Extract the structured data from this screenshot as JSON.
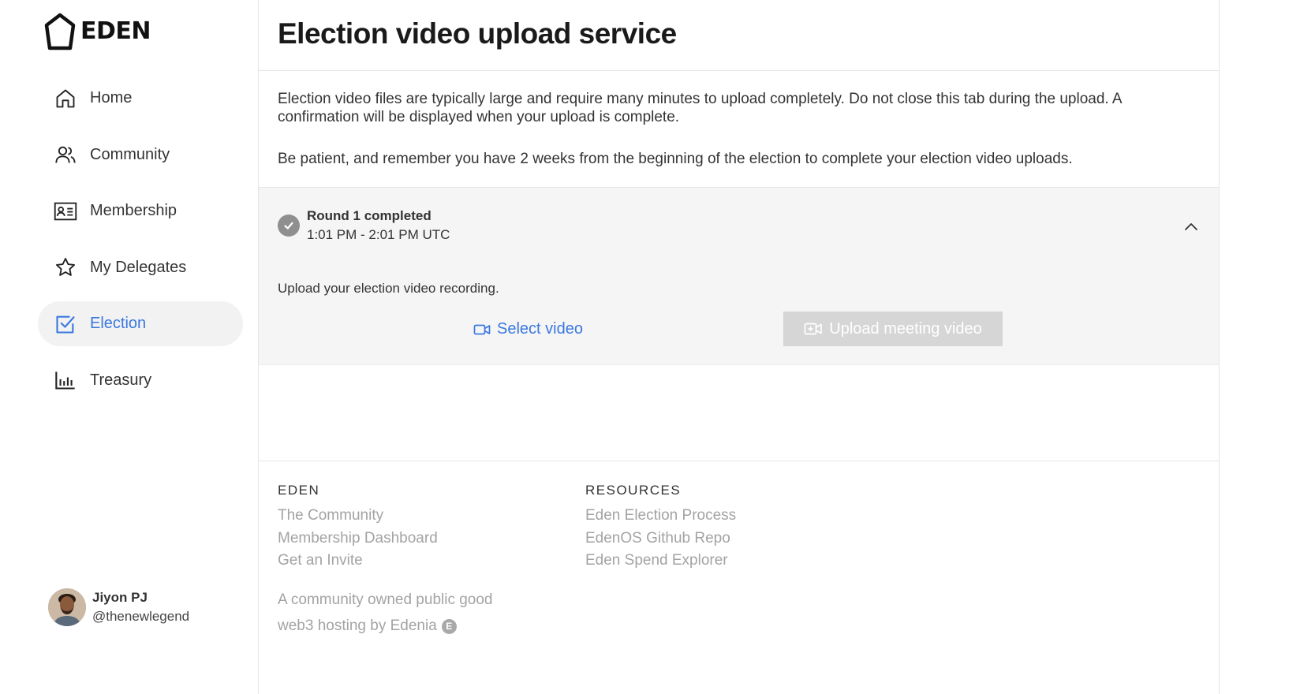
{
  "brand": {
    "logo_text": "EDEN",
    "logo_icon": "pentagon-logo-icon"
  },
  "sidebar": {
    "items": [
      {
        "label": "Home",
        "icon": "home-icon",
        "active": false
      },
      {
        "label": "Community",
        "icon": "users-icon",
        "active": false
      },
      {
        "label": "Membership",
        "icon": "id-card-icon",
        "active": false
      },
      {
        "label": "My Delegates",
        "icon": "star-icon",
        "active": false
      },
      {
        "label": "Election",
        "icon": "checkbox-icon",
        "active": true
      },
      {
        "label": "Treasury",
        "icon": "bar-chart-icon",
        "active": false
      }
    ],
    "user": {
      "name": "Jiyon PJ",
      "handle": "@thenewlegend"
    }
  },
  "main": {
    "title": "Election video upload service",
    "intro": [
      "Election video files are typically large and require many minutes to upload completely. Do not close this tab during the upload. A confirmation will be displayed when your upload is complete.",
      "Be patient, and remember you have 2 weeks from the beginning of the election to complete your election video uploads."
    ],
    "round": {
      "title": "Round 1 completed",
      "time": "1:01 PM - 2:01 PM UTC",
      "upload_prompt": "Upload your election video recording.",
      "select_label": "Select video",
      "upload_label": "Upload meeting video",
      "upload_enabled": false
    }
  },
  "footer": {
    "eden": {
      "heading": "EDEN",
      "links": [
        "The Community",
        "Membership Dashboard",
        "Get an Invite"
      ]
    },
    "resources": {
      "heading": "RESOURCES",
      "links": [
        "Eden Election Process",
        "EdenOS Github Repo",
        "Eden Spend Explorer"
      ]
    },
    "tagline": "A community owned public good",
    "hosting": "web3 hosting by Edenia",
    "hosting_icon_letter": "E"
  },
  "colors": {
    "accent": "#3a78e0",
    "muted_text": "#a3a3a3",
    "panel_bg": "#f5f5f5",
    "disabled_button": "#d6d6d6"
  }
}
